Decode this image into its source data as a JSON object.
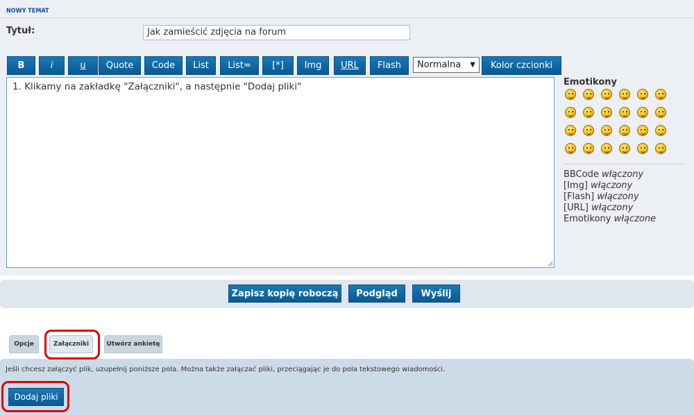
{
  "header": {
    "section_title": "NOWY TEMAT"
  },
  "form": {
    "title_label": "Tytuł:",
    "title_value": "Jak zamieścić zdjęcia na forum"
  },
  "toolbar": {
    "buttons": [
      "B",
      "i",
      "u",
      "Quote",
      "Code",
      "List",
      "List=",
      "[*]",
      "Img",
      "URL",
      "Flash"
    ],
    "font_size_value": "Normalna",
    "font_color_label": "Kolor czcionki"
  },
  "editor": {
    "text": "1. Klikamy na zakładkę \"Załączniki\", a następnie \"Dodaj pliki\""
  },
  "sidebar": {
    "emoticons_title": "Emotikony",
    "emoticon_icons": [
      "grin-icon",
      "neutral-smile-icon",
      "smile-icon",
      "surprised-icon",
      "shocked-icon",
      "confused-icon",
      "cool-icon",
      "sunglasses-icon",
      "laugh-icon",
      "mad-icon",
      "razz-icon",
      "embarrassed-icon",
      "crying-icon",
      "evil-icon",
      "twisted-icon",
      "rolleyes-icon",
      "exclamation-icon",
      "question-icon",
      "idea-icon",
      "arrow-icon",
      "neutral-icon",
      "mrgreen-icon",
      "geek-icon",
      "uber-geek-icon"
    ],
    "status": [
      {
        "name": "BBCode",
        "state": "włączony"
      },
      {
        "name": "[Img]",
        "state": "włączony"
      },
      {
        "name": "[Flash]",
        "state": "włączony"
      },
      {
        "name": "[URL]",
        "state": "włączony"
      },
      {
        "name": "Emotikony",
        "state": "włączone"
      }
    ]
  },
  "actions": {
    "save_draft": "Zapisz kopię roboczą",
    "preview": "Podgląd",
    "submit": "Wyślij"
  },
  "tabs": [
    "Opcje",
    "Załączniki",
    "Utwórz ankietę"
  ],
  "attachments": {
    "help_text": "Jeśli chcesz załączyć plik, uzupełnij poniższe pola. Można także załączać pliki, przeciągając je do pola tekstowego wiadomości.",
    "add_files_label": "Dodaj pliki"
  },
  "colors": {
    "accent": "#0a5a93",
    "highlight": "#e00000",
    "panel": "#eceff3"
  }
}
